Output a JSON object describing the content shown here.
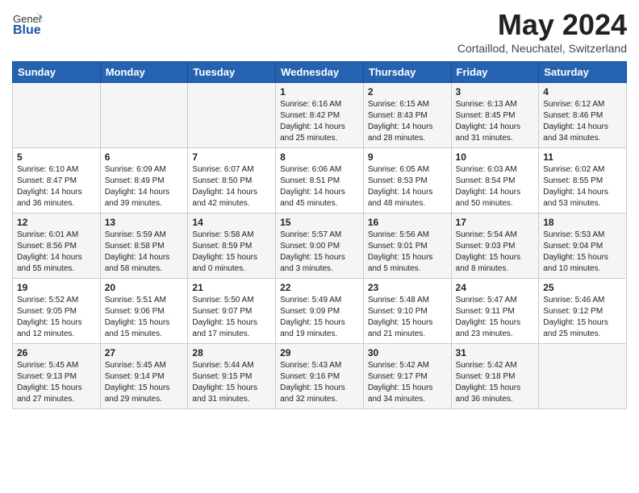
{
  "header": {
    "logo_general": "General",
    "logo_blue": "Blue",
    "month_title": "May 2024",
    "subtitle": "Cortaillod, Neuchatel, Switzerland"
  },
  "days_of_week": [
    "Sunday",
    "Monday",
    "Tuesday",
    "Wednesday",
    "Thursday",
    "Friday",
    "Saturday"
  ],
  "weeks": [
    [
      {
        "day": "",
        "info": ""
      },
      {
        "day": "",
        "info": ""
      },
      {
        "day": "",
        "info": ""
      },
      {
        "day": "1",
        "info": "Sunrise: 6:16 AM\nSunset: 8:42 PM\nDaylight: 14 hours and 25 minutes."
      },
      {
        "day": "2",
        "info": "Sunrise: 6:15 AM\nSunset: 8:43 PM\nDaylight: 14 hours and 28 minutes."
      },
      {
        "day": "3",
        "info": "Sunrise: 6:13 AM\nSunset: 8:45 PM\nDaylight: 14 hours and 31 minutes."
      },
      {
        "day": "4",
        "info": "Sunrise: 6:12 AM\nSunset: 8:46 PM\nDaylight: 14 hours and 34 minutes."
      }
    ],
    [
      {
        "day": "5",
        "info": "Sunrise: 6:10 AM\nSunset: 8:47 PM\nDaylight: 14 hours and 36 minutes."
      },
      {
        "day": "6",
        "info": "Sunrise: 6:09 AM\nSunset: 8:49 PM\nDaylight: 14 hours and 39 minutes."
      },
      {
        "day": "7",
        "info": "Sunrise: 6:07 AM\nSunset: 8:50 PM\nDaylight: 14 hours and 42 minutes."
      },
      {
        "day": "8",
        "info": "Sunrise: 6:06 AM\nSunset: 8:51 PM\nDaylight: 14 hours and 45 minutes."
      },
      {
        "day": "9",
        "info": "Sunrise: 6:05 AM\nSunset: 8:53 PM\nDaylight: 14 hours and 48 minutes."
      },
      {
        "day": "10",
        "info": "Sunrise: 6:03 AM\nSunset: 8:54 PM\nDaylight: 14 hours and 50 minutes."
      },
      {
        "day": "11",
        "info": "Sunrise: 6:02 AM\nSunset: 8:55 PM\nDaylight: 14 hours and 53 minutes."
      }
    ],
    [
      {
        "day": "12",
        "info": "Sunrise: 6:01 AM\nSunset: 8:56 PM\nDaylight: 14 hours and 55 minutes."
      },
      {
        "day": "13",
        "info": "Sunrise: 5:59 AM\nSunset: 8:58 PM\nDaylight: 14 hours and 58 minutes."
      },
      {
        "day": "14",
        "info": "Sunrise: 5:58 AM\nSunset: 8:59 PM\nDaylight: 15 hours and 0 minutes."
      },
      {
        "day": "15",
        "info": "Sunrise: 5:57 AM\nSunset: 9:00 PM\nDaylight: 15 hours and 3 minutes."
      },
      {
        "day": "16",
        "info": "Sunrise: 5:56 AM\nSunset: 9:01 PM\nDaylight: 15 hours and 5 minutes."
      },
      {
        "day": "17",
        "info": "Sunrise: 5:54 AM\nSunset: 9:03 PM\nDaylight: 15 hours and 8 minutes."
      },
      {
        "day": "18",
        "info": "Sunrise: 5:53 AM\nSunset: 9:04 PM\nDaylight: 15 hours and 10 minutes."
      }
    ],
    [
      {
        "day": "19",
        "info": "Sunrise: 5:52 AM\nSunset: 9:05 PM\nDaylight: 15 hours and 12 minutes."
      },
      {
        "day": "20",
        "info": "Sunrise: 5:51 AM\nSunset: 9:06 PM\nDaylight: 15 hours and 15 minutes."
      },
      {
        "day": "21",
        "info": "Sunrise: 5:50 AM\nSunset: 9:07 PM\nDaylight: 15 hours and 17 minutes."
      },
      {
        "day": "22",
        "info": "Sunrise: 5:49 AM\nSunset: 9:09 PM\nDaylight: 15 hours and 19 minutes."
      },
      {
        "day": "23",
        "info": "Sunrise: 5:48 AM\nSunset: 9:10 PM\nDaylight: 15 hours and 21 minutes."
      },
      {
        "day": "24",
        "info": "Sunrise: 5:47 AM\nSunset: 9:11 PM\nDaylight: 15 hours and 23 minutes."
      },
      {
        "day": "25",
        "info": "Sunrise: 5:46 AM\nSunset: 9:12 PM\nDaylight: 15 hours and 25 minutes."
      }
    ],
    [
      {
        "day": "26",
        "info": "Sunrise: 5:45 AM\nSunset: 9:13 PM\nDaylight: 15 hours and 27 minutes."
      },
      {
        "day": "27",
        "info": "Sunrise: 5:45 AM\nSunset: 9:14 PM\nDaylight: 15 hours and 29 minutes."
      },
      {
        "day": "28",
        "info": "Sunrise: 5:44 AM\nSunset: 9:15 PM\nDaylight: 15 hours and 31 minutes."
      },
      {
        "day": "29",
        "info": "Sunrise: 5:43 AM\nSunset: 9:16 PM\nDaylight: 15 hours and 32 minutes."
      },
      {
        "day": "30",
        "info": "Sunrise: 5:42 AM\nSunset: 9:17 PM\nDaylight: 15 hours and 34 minutes."
      },
      {
        "day": "31",
        "info": "Sunrise: 5:42 AM\nSunset: 9:18 PM\nDaylight: 15 hours and 36 minutes."
      },
      {
        "day": "",
        "info": ""
      }
    ]
  ]
}
